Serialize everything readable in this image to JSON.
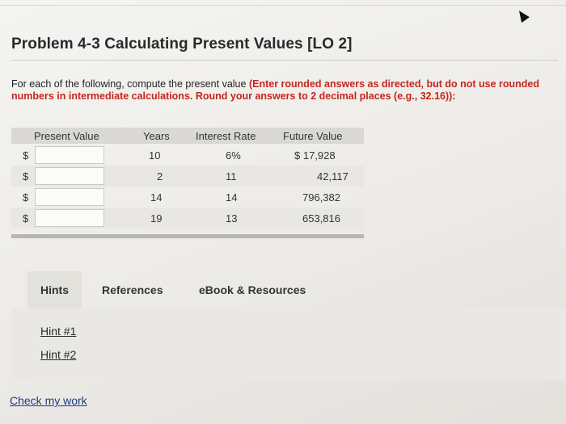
{
  "problem": {
    "title": "Problem 4-3 Calculating Present Values [LO 2]",
    "instruction_plain": "For each of the following, compute the present value",
    "instruction_red": "(Enter rounded answers as directed, but do not use rounded numbers in intermediate calculations. Round your answers to 2 decimal places (e.g., 32.16)):"
  },
  "table": {
    "headers": [
      "Present Value",
      "Years",
      "Interest Rate",
      "Future Value"
    ],
    "rows": [
      {
        "currency": "$",
        "present_value": "",
        "years": "10",
        "rate": "6%",
        "future_value": "$ 17,928"
      },
      {
        "currency": "$",
        "present_value": "",
        "years": "2",
        "rate": "11",
        "future_value": "42,117"
      },
      {
        "currency": "$",
        "present_value": "",
        "years": "14",
        "rate": "14",
        "future_value": "796,382"
      },
      {
        "currency": "$",
        "present_value": "",
        "years": "19",
        "rate": "13",
        "future_value": "653,816"
      }
    ]
  },
  "tabs": [
    "Hints",
    "References",
    "eBook & Resources"
  ],
  "hints": [
    "Hint #1",
    "Hint #2"
  ],
  "footer": {
    "check_label": "Check my work"
  }
}
